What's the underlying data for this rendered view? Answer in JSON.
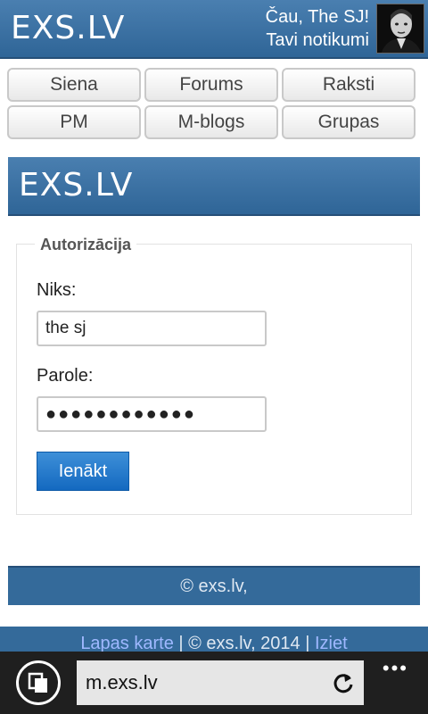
{
  "header": {
    "logo": "EXS.LV",
    "greeting": "Čau, The SJ!",
    "events_link": "Tavi notikumi"
  },
  "nav": {
    "items": [
      {
        "label": "Siena"
      },
      {
        "label": "Forums"
      },
      {
        "label": "Raksti"
      },
      {
        "label": "PM"
      },
      {
        "label": "M-blogs"
      },
      {
        "label": "Grupas"
      }
    ]
  },
  "banner": {
    "logo": "EXS.LV"
  },
  "login": {
    "legend": "Autorizācija",
    "nick_label": "Niks:",
    "nick_value": "the sj",
    "password_label": "Parole:",
    "password_value": "●●●●●●●●●●●●",
    "submit_label": "Ienākt"
  },
  "footer": {
    "copyright": "© exs.lv,",
    "sitemap_link": "Lapas karte",
    "separator1": " | © exs.lv, 2014 | ",
    "logout_link": "Iziet"
  },
  "browser": {
    "url": "m.exs.lv",
    "more": "•••"
  }
}
